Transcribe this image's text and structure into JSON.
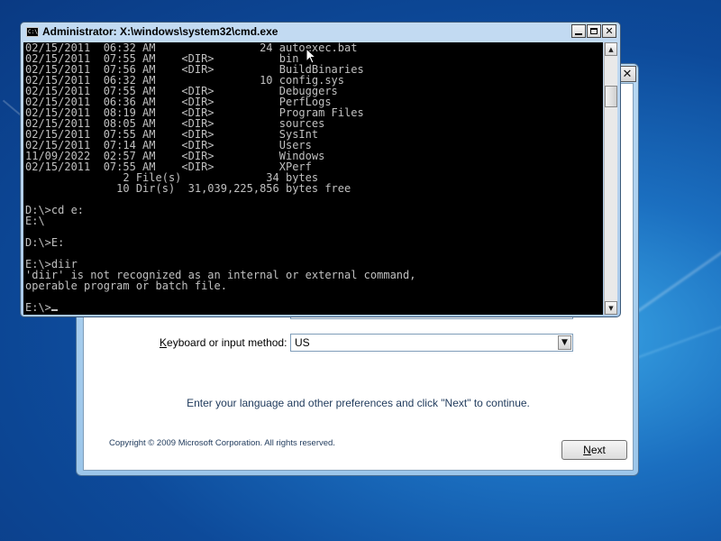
{
  "setup": {
    "close_glyph": "✕",
    "keyboard_label_prefix": "",
    "keyboard_label_accel": "K",
    "keyboard_label_rest": "eyboard or input method:",
    "keyboard_value": "US",
    "instructions": "Enter your language and other preferences and click \"Next\" to continue.",
    "copyright": "Copyright © 2009 Microsoft Corporation. All rights reserved.",
    "next_accel": "N",
    "next_rest": "ext"
  },
  "cmd": {
    "icon_text": "C:\\",
    "title": "Administrator: X:\\windows\\system32\\cmd.exe",
    "close_glyph": "✕",
    "lines": [
      "02/15/2011  06:32 AM                24 autoexec.bat",
      "02/15/2011  07:55 AM    <DIR>          bin",
      "02/15/2011  07:56 AM    <DIR>          BuildBinaries",
      "02/15/2011  06:32 AM                10 config.sys",
      "02/15/2011  07:55 AM    <DIR>          Debuggers",
      "02/15/2011  06:36 AM    <DIR>          PerfLogs",
      "02/15/2011  08:19 AM    <DIR>          Program Files",
      "02/15/2011  08:05 AM    <DIR>          sources",
      "02/15/2011  07:55 AM    <DIR>          SysInt",
      "02/15/2011  07:14 AM    <DIR>          Users",
      "11/09/2022  02:57 AM    <DIR>          Windows",
      "02/15/2011  07:55 AM    <DIR>          XPerf",
      "               2 File(s)             34 bytes",
      "              10 Dir(s)  31,039,225,856 bytes free",
      "",
      "D:\\>cd e:",
      "E:\\",
      "",
      "D:\\>E:",
      "",
      "E:\\>diir",
      "'diir' is not recognized as an internal or external command,",
      "operable program or batch file.",
      "",
      "E:\\>"
    ]
  },
  "icons": {
    "scroll_up": "▲",
    "scroll_down": "▼",
    "dropdown": "▼"
  }
}
